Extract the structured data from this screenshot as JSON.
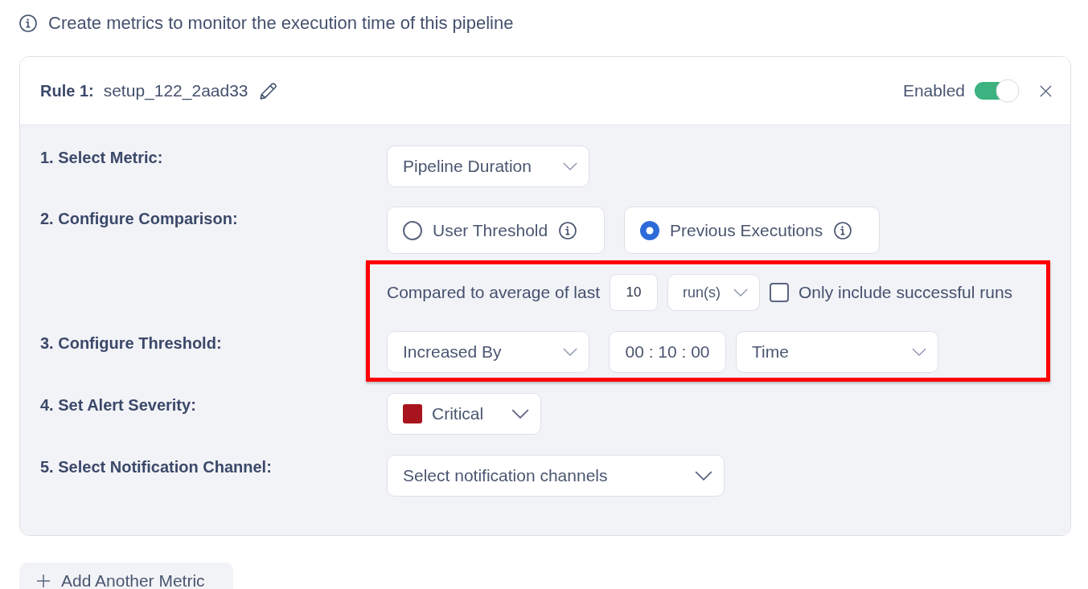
{
  "info": {
    "text": "Create metrics to monitor the execution time of this pipeline"
  },
  "rule": {
    "title": "Rule 1:",
    "name": "setup_122_2aad33",
    "toggle_label": "Enabled",
    "enabled": true
  },
  "metric": {
    "label": "1. Select Metric:",
    "value": "Pipeline Duration"
  },
  "comparison": {
    "label": "2. Configure Comparison:",
    "options": [
      {
        "label": "User Threshold",
        "selected": false
      },
      {
        "label": "Previous Executions",
        "selected": true
      }
    ]
  },
  "threshold": {
    "label": "3. Configure Threshold:",
    "highlighted": true,
    "average_text": "Compared to average of last",
    "count": "10",
    "unit": "run(s)",
    "successful_only": {
      "label": "Only include successful runs",
      "checked": false
    },
    "direction": "Increased By",
    "duration": "00 : 10 : 00",
    "measure": "Time"
  },
  "severity": {
    "label": "4. Set Alert Severity:",
    "value": "Critical",
    "color": "#a8141e"
  },
  "channel": {
    "label": "5. Select Notification Channel:",
    "placeholder": "Select notification channels"
  },
  "add_button": {
    "label": "Add Another Metric"
  }
}
